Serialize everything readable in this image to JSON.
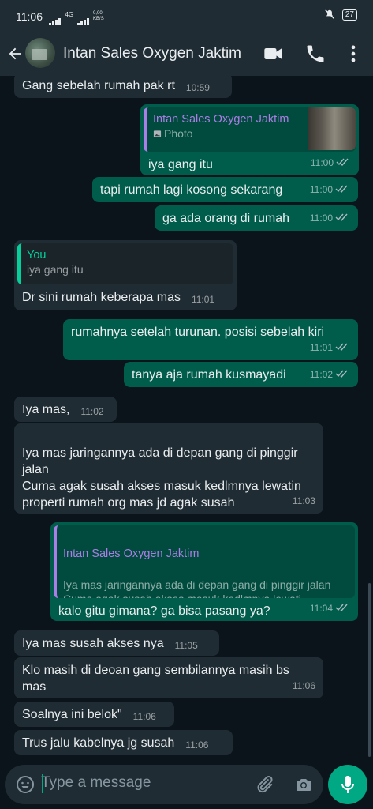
{
  "status_bar": {
    "time": "11:06",
    "net": "4G",
    "speed": "0,00 KB/S",
    "battery": "27"
  },
  "header": {
    "contact_name": "Intan Sales Oxygen Jaktim"
  },
  "messages": [
    {
      "dir": "in",
      "text": "Gang sebelah rumah pak rt",
      "time": "10:59"
    },
    {
      "dir": "out",
      "quote_name": "Intan Sales Oxygen Jaktim",
      "quote_icon": "photo-icon",
      "quote_text": "Photo",
      "text": "iya gang itu",
      "time": "11:00",
      "status": "read"
    },
    {
      "dir": "out",
      "text": "tapi rumah lagi kosong sekarang",
      "time": "11:00",
      "status": "read"
    },
    {
      "dir": "out",
      "text": "ga ada orang di rumah",
      "time": "11:00",
      "status": "read"
    },
    {
      "dir": "in",
      "quote_name": "You",
      "quote_text": "iya gang itu",
      "text": "Dr sini rumah keberapa mas",
      "time": "11:01"
    },
    {
      "dir": "out",
      "text": "rumahnya setelah turunan. posisi sebelah kiri",
      "time": "11:01",
      "status": "read"
    },
    {
      "dir": "out",
      "text": "tanya aja rumah kusmayadi",
      "time": "11:02",
      "status": "read"
    },
    {
      "dir": "in",
      "text": "Iya mas,",
      "time": "11:02"
    },
    {
      "dir": "in",
      "text": "Iya mas jaringannya ada di depan gang di pinggir jalan\nCuma agak susah akses masuk kedlmnya lewatin properti rumah org mas jd agak susah",
      "time": "11:03"
    },
    {
      "dir": "out",
      "quote_name": "Intan Sales Oxygen Jaktim",
      "quote_text": "Iya mas jaringannya ada di depan gang di pinggir jalan\nCuma agak susah akses masuk kedlmnya lewati…",
      "text": "kalo gitu gimana? ga bisa pasang ya?",
      "time": "11:04",
      "status": "read"
    },
    {
      "dir": "in",
      "text": "Iya mas susah akses nya",
      "time": "11:05"
    },
    {
      "dir": "in",
      "text": "Klo masih di deoan gang sembilannya masih bs mas",
      "time": "11:06"
    },
    {
      "dir": "in",
      "text": "Soalnya ini belok\"",
      "time": "11:06"
    },
    {
      "dir": "in",
      "text": "Trus jalu kabelnya jg susah",
      "time": "11:06"
    }
  ],
  "input": {
    "placeholder": "Type a message"
  },
  "colors": {
    "bg": "#0b141a",
    "bar": "#1f2c34",
    "incoming": "#202c33",
    "outgoing": "#005c4b",
    "accent": "#00a884",
    "read_ticks": "#53bdeb"
  }
}
